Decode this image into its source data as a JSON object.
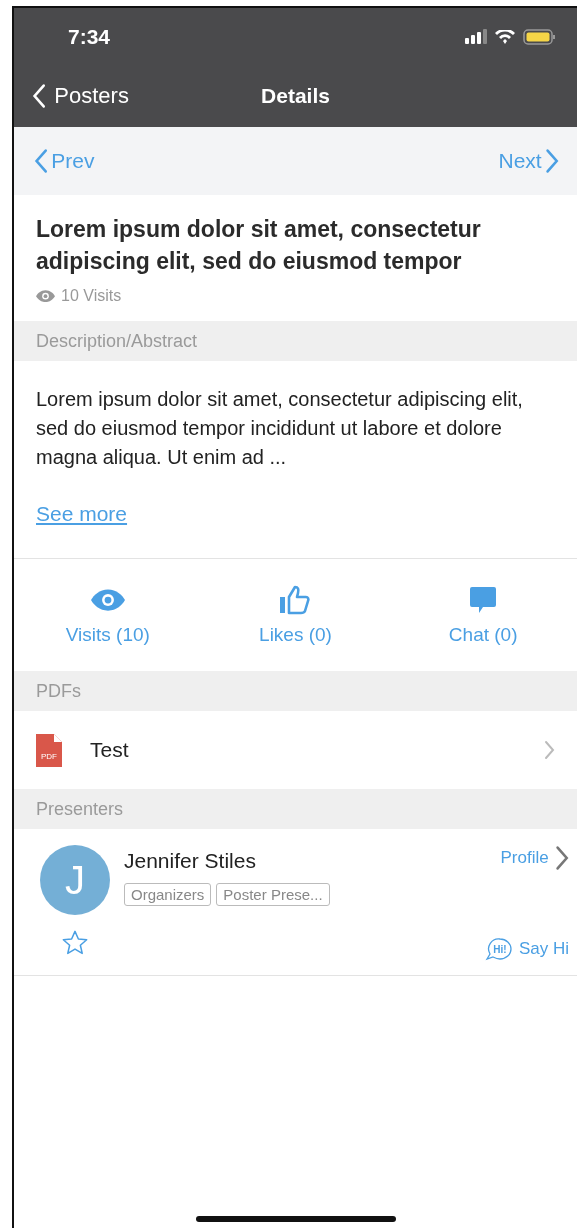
{
  "status_bar": {
    "time": "7:34"
  },
  "nav_bar": {
    "back_label": "Posters",
    "title": "Details"
  },
  "pager": {
    "prev": "Prev",
    "next": "Next"
  },
  "poster": {
    "title": "Lorem ipsum dolor sit amet, consectetur adipiscing elit, sed do eiusmod tempor",
    "visits": "10 Visits"
  },
  "description": {
    "header": "Description/Abstract",
    "text": "Lorem ipsum dolor sit amet, consectetur adipiscing elit, sed do eiusmod tempor incididunt ut labore et dolore magna aliqua. Ut enim ad ...",
    "see_more": "See more"
  },
  "stats": [
    {
      "kind": "visits",
      "label": "Visits (10)"
    },
    {
      "kind": "likes",
      "label": "Likes (0)"
    },
    {
      "kind": "chat",
      "label": "Chat (0)"
    }
  ],
  "pdfs": {
    "header": "PDFs",
    "items": [
      {
        "name": "Test",
        "badge": "PDF"
      }
    ]
  },
  "presenters": {
    "header": "Presenters",
    "items": [
      {
        "initial": "J",
        "name": "Jennifer Stiles",
        "tags": [
          "Organizers",
          "Poster Prese..."
        ],
        "profile": "Profile",
        "favorited": false,
        "say_hi_badge": "Hi!",
        "say_hi": "Say Hi"
      }
    ]
  }
}
